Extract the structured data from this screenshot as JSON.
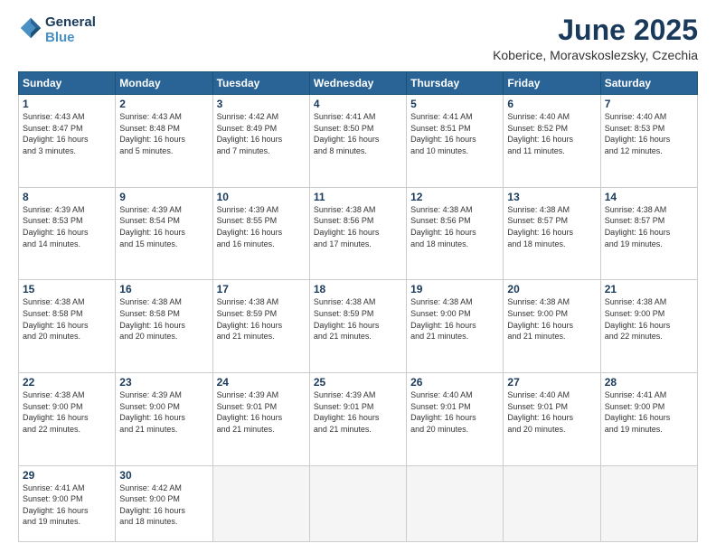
{
  "header": {
    "logo_line1": "General",
    "logo_line2": "Blue",
    "title": "June 2025",
    "location": "Koberice, Moravskoslezsky, Czechia"
  },
  "days_of_week": [
    "Sunday",
    "Monday",
    "Tuesday",
    "Wednesday",
    "Thursday",
    "Friday",
    "Saturday"
  ],
  "weeks": [
    [
      {
        "day": "1",
        "info": "Sunrise: 4:43 AM\nSunset: 8:47 PM\nDaylight: 16 hours\nand 3 minutes."
      },
      {
        "day": "2",
        "info": "Sunrise: 4:43 AM\nSunset: 8:48 PM\nDaylight: 16 hours\nand 5 minutes."
      },
      {
        "day": "3",
        "info": "Sunrise: 4:42 AM\nSunset: 8:49 PM\nDaylight: 16 hours\nand 7 minutes."
      },
      {
        "day": "4",
        "info": "Sunrise: 4:41 AM\nSunset: 8:50 PM\nDaylight: 16 hours\nand 8 minutes."
      },
      {
        "day": "5",
        "info": "Sunrise: 4:41 AM\nSunset: 8:51 PM\nDaylight: 16 hours\nand 10 minutes."
      },
      {
        "day": "6",
        "info": "Sunrise: 4:40 AM\nSunset: 8:52 PM\nDaylight: 16 hours\nand 11 minutes."
      },
      {
        "day": "7",
        "info": "Sunrise: 4:40 AM\nSunset: 8:53 PM\nDaylight: 16 hours\nand 12 minutes."
      }
    ],
    [
      {
        "day": "8",
        "info": "Sunrise: 4:39 AM\nSunset: 8:53 PM\nDaylight: 16 hours\nand 14 minutes."
      },
      {
        "day": "9",
        "info": "Sunrise: 4:39 AM\nSunset: 8:54 PM\nDaylight: 16 hours\nand 15 minutes."
      },
      {
        "day": "10",
        "info": "Sunrise: 4:39 AM\nSunset: 8:55 PM\nDaylight: 16 hours\nand 16 minutes."
      },
      {
        "day": "11",
        "info": "Sunrise: 4:38 AM\nSunset: 8:56 PM\nDaylight: 16 hours\nand 17 minutes."
      },
      {
        "day": "12",
        "info": "Sunrise: 4:38 AM\nSunset: 8:56 PM\nDaylight: 16 hours\nand 18 minutes."
      },
      {
        "day": "13",
        "info": "Sunrise: 4:38 AM\nSunset: 8:57 PM\nDaylight: 16 hours\nand 18 minutes."
      },
      {
        "day": "14",
        "info": "Sunrise: 4:38 AM\nSunset: 8:57 PM\nDaylight: 16 hours\nand 19 minutes."
      }
    ],
    [
      {
        "day": "15",
        "info": "Sunrise: 4:38 AM\nSunset: 8:58 PM\nDaylight: 16 hours\nand 20 minutes."
      },
      {
        "day": "16",
        "info": "Sunrise: 4:38 AM\nSunset: 8:58 PM\nDaylight: 16 hours\nand 20 minutes."
      },
      {
        "day": "17",
        "info": "Sunrise: 4:38 AM\nSunset: 8:59 PM\nDaylight: 16 hours\nand 21 minutes."
      },
      {
        "day": "18",
        "info": "Sunrise: 4:38 AM\nSunset: 8:59 PM\nDaylight: 16 hours\nand 21 minutes."
      },
      {
        "day": "19",
        "info": "Sunrise: 4:38 AM\nSunset: 9:00 PM\nDaylight: 16 hours\nand 21 minutes."
      },
      {
        "day": "20",
        "info": "Sunrise: 4:38 AM\nSunset: 9:00 PM\nDaylight: 16 hours\nand 21 minutes."
      },
      {
        "day": "21",
        "info": "Sunrise: 4:38 AM\nSunset: 9:00 PM\nDaylight: 16 hours\nand 22 minutes."
      }
    ],
    [
      {
        "day": "22",
        "info": "Sunrise: 4:38 AM\nSunset: 9:00 PM\nDaylight: 16 hours\nand 22 minutes."
      },
      {
        "day": "23",
        "info": "Sunrise: 4:39 AM\nSunset: 9:00 PM\nDaylight: 16 hours\nand 21 minutes."
      },
      {
        "day": "24",
        "info": "Sunrise: 4:39 AM\nSunset: 9:01 PM\nDaylight: 16 hours\nand 21 minutes."
      },
      {
        "day": "25",
        "info": "Sunrise: 4:39 AM\nSunset: 9:01 PM\nDaylight: 16 hours\nand 21 minutes."
      },
      {
        "day": "26",
        "info": "Sunrise: 4:40 AM\nSunset: 9:01 PM\nDaylight: 16 hours\nand 20 minutes."
      },
      {
        "day": "27",
        "info": "Sunrise: 4:40 AM\nSunset: 9:01 PM\nDaylight: 16 hours\nand 20 minutes."
      },
      {
        "day": "28",
        "info": "Sunrise: 4:41 AM\nSunset: 9:00 PM\nDaylight: 16 hours\nand 19 minutes."
      }
    ],
    [
      {
        "day": "29",
        "info": "Sunrise: 4:41 AM\nSunset: 9:00 PM\nDaylight: 16 hours\nand 19 minutes."
      },
      {
        "day": "30",
        "info": "Sunrise: 4:42 AM\nSunset: 9:00 PM\nDaylight: 16 hours\nand 18 minutes."
      },
      {
        "day": "",
        "info": ""
      },
      {
        "day": "",
        "info": ""
      },
      {
        "day": "",
        "info": ""
      },
      {
        "day": "",
        "info": ""
      },
      {
        "day": "",
        "info": ""
      }
    ]
  ]
}
